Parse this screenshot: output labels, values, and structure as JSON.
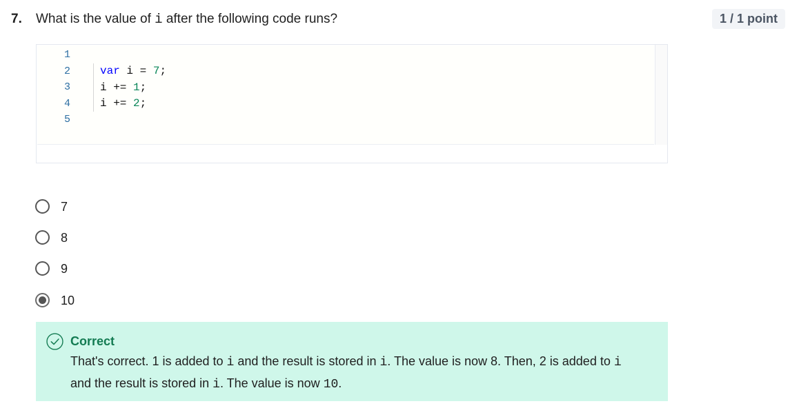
{
  "question": {
    "number": "7.",
    "text_before": "What is the value of ",
    "var_name": "i",
    "text_after": " after the following code runs?"
  },
  "score": "1 / 1 point",
  "code": {
    "line_numbers": [
      "1",
      "2",
      "3",
      "4",
      "5"
    ],
    "lines": [
      {
        "parts": [
          {
            "t": "var",
            "c": "kw"
          },
          {
            "t": " i = ",
            "c": ""
          },
          {
            "t": "7",
            "c": "num"
          },
          {
            "t": ";",
            "c": ""
          }
        ]
      },
      {
        "parts": [
          {
            "t": "i += ",
            "c": ""
          },
          {
            "t": "1",
            "c": "num"
          },
          {
            "t": ";",
            "c": ""
          }
        ]
      },
      {
        "parts": [
          {
            "t": "i += ",
            "c": ""
          },
          {
            "t": "2",
            "c": "num"
          },
          {
            "t": ";",
            "c": ""
          }
        ]
      }
    ]
  },
  "options": [
    {
      "label": "7",
      "checked": false
    },
    {
      "label": "8",
      "checked": false
    },
    {
      "label": "9",
      "checked": false
    },
    {
      "label": "10",
      "checked": true
    }
  ],
  "feedback": {
    "title": "Correct",
    "text_parts": [
      {
        "t": "That's correct. 1 is added to ",
        "mono": false
      },
      {
        "t": "i",
        "mono": true
      },
      {
        "t": " and the result is stored in ",
        "mono": false
      },
      {
        "t": "i",
        "mono": true
      },
      {
        "t": ". The value is now 8. Then, 2 is added to ",
        "mono": false
      },
      {
        "t": "i",
        "mono": true
      },
      {
        "t": " and the result is stored in ",
        "mono": false
      },
      {
        "t": "i",
        "mono": true
      },
      {
        "t": ". The value is now ",
        "mono": false
      },
      {
        "t": "10",
        "mono": true
      },
      {
        "t": ".",
        "mono": false
      }
    ],
    "color": "#137b52",
    "background": "#cff7ea"
  }
}
